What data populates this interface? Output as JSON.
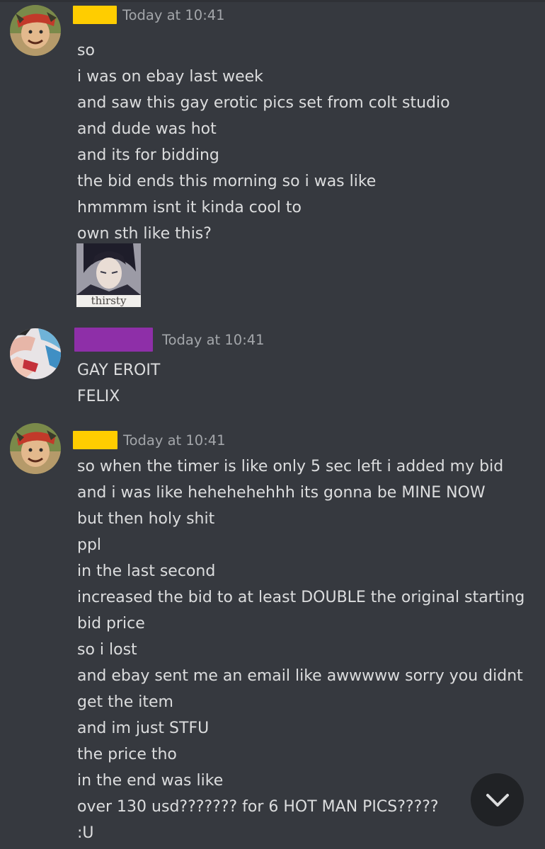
{
  "messages": [
    {
      "username_color": "#ffcd00",
      "timestamp": "Today at 10:41",
      "lines": [
        "so",
        "i was on ebay last week",
        "and saw this gay erotic pics set from colt studio",
        "and dude was hot",
        "and its for bidding",
        "the bid ends this morning so i was like",
        "hmmmm isnt it kinda cool to",
        "own sth like this?"
      ],
      "sticker": {
        "caption": "thirsty"
      }
    },
    {
      "username_color": "#8e2fa8",
      "timestamp": "Today at 10:41",
      "lines": [
        "GAY EROIT",
        "FELIX"
      ]
    },
    {
      "username_color": "#ffcd00",
      "timestamp": "Today at 10:41",
      "lines": [
        "so when the timer is like only 5 sec left i added my bid",
        "and i was like hehehehehhh its gonna be MINE NOW",
        "but then holy shit",
        "ppl",
        "in the last second",
        "increased the bid to at least DOUBLE the original starting",
        "bid price",
        "so i lost",
        "and ebay sent me an email like awwwww sorry you didnt",
        "get the item",
        "and im just STFU",
        "the price tho",
        "in the end was like",
        "over 130 usd??????? for 6 HOT MAN PICS?????",
        ":U"
      ]
    }
  ],
  "scroll_button": {
    "icon": "chevron-down-icon"
  },
  "colors": {
    "background": "#36393f",
    "text": "#dcddde",
    "timestamp": "#a3a6aa",
    "scroll_button_bg": "#202225"
  }
}
